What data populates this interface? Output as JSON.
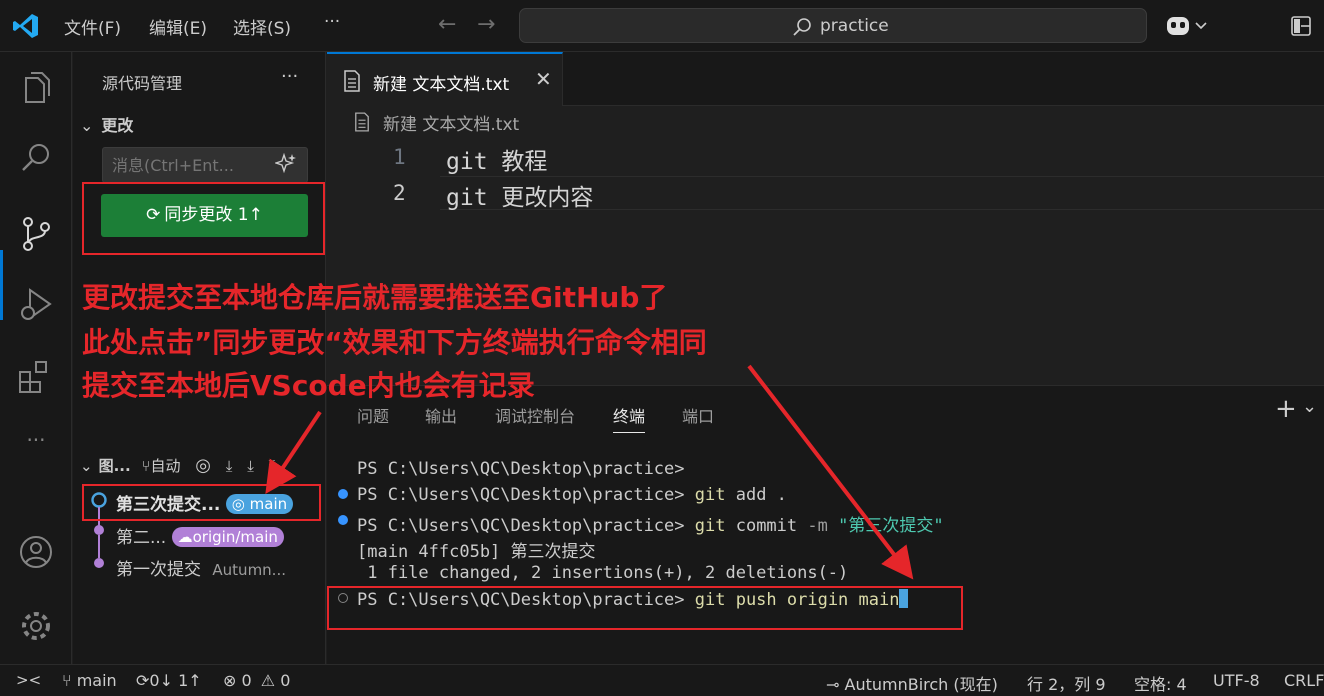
{
  "titlebar": {
    "menu": [
      "文件(F)",
      "编辑(E)",
      "选择(S)"
    ],
    "more": "···",
    "back": "←",
    "forward": "→",
    "search_text": "practice",
    "copilot_chevron": "⌄"
  },
  "activitybar": {
    "icons": [
      "explorer-icon",
      "search-icon",
      "source-control-icon",
      "run-debug-icon",
      "extensions-icon",
      "more-icon",
      "account-icon",
      "settings-icon"
    ],
    "more_label": "···"
  },
  "sidebar": {
    "title": "源代码管理",
    "more": "···",
    "section_title": "更改",
    "message_placeholder": "消息(Ctrl+Ent...",
    "sync_button": "同步更改 1↑",
    "graph": {
      "header_label": "图...",
      "auto_label": "自动",
      "commits": [
        {
          "title": "第三次提交...",
          "badge": "main",
          "badge_color": "#4aa3df"
        },
        {
          "title": "第二...",
          "badge": "origin/main",
          "badge_color": "#b180d7"
        },
        {
          "title": "第一次提交",
          "author": "Autumn..."
        }
      ]
    }
  },
  "editor": {
    "tab_label": "新建 文本文档.txt",
    "tab_close": "✕",
    "breadcrumb": "新建 文本文档.txt",
    "lines": [
      {
        "num": "1",
        "text": "git 教程"
      },
      {
        "num": "2",
        "text": "git 更改内容"
      }
    ]
  },
  "panel": {
    "tabs": [
      "问题",
      "输出",
      "调试控制台",
      "终端",
      "端口"
    ],
    "active_tab": "终端",
    "add": "+",
    "chevron": "⌄",
    "terminal": {
      "l1": "PS C:\\Users\\QC\\Desktop\\practice>",
      "l2_prompt": "PS C:\\Users\\QC\\Desktop\\practice> ",
      "l2_cmd": "git",
      "l2_args": " add .",
      "l3_prompt": "PS C:\\Users\\QC\\Desktop\\practice> ",
      "l3_cmd": "git",
      "l3_args": " commit ",
      "l3_flag": "-m",
      "l3_msg": " \"第三次提交\"",
      "l4": "[main 4ffc05b] 第三次提交",
      "l5": " 1 file changed, 2 insertions(+), 2 deletions(-)",
      "l6_prompt": "PS C:\\Users\\QC\\Desktop\\practice> ",
      "l6_cmd": "git push origin main"
    }
  },
  "statusbar": {
    "remote_icon": "><",
    "branch": "main",
    "sync": "0↓ 1↑",
    "errors": "0",
    "warnings": "0",
    "blame": "AutumnBirch (现在)",
    "position": "行 2，列 9",
    "spaces": "空格: 4",
    "encoding": "UTF-8",
    "eol": "CRLF"
  },
  "annotation": {
    "line1": "更改提交至本地仓库后就需要推送至GitHub了",
    "line2": "此处点击”同步更改“效果和下方终端执行命令相同",
    "line3": "提交至本地后VScode内也会有记录",
    "color": "#e5262a"
  }
}
